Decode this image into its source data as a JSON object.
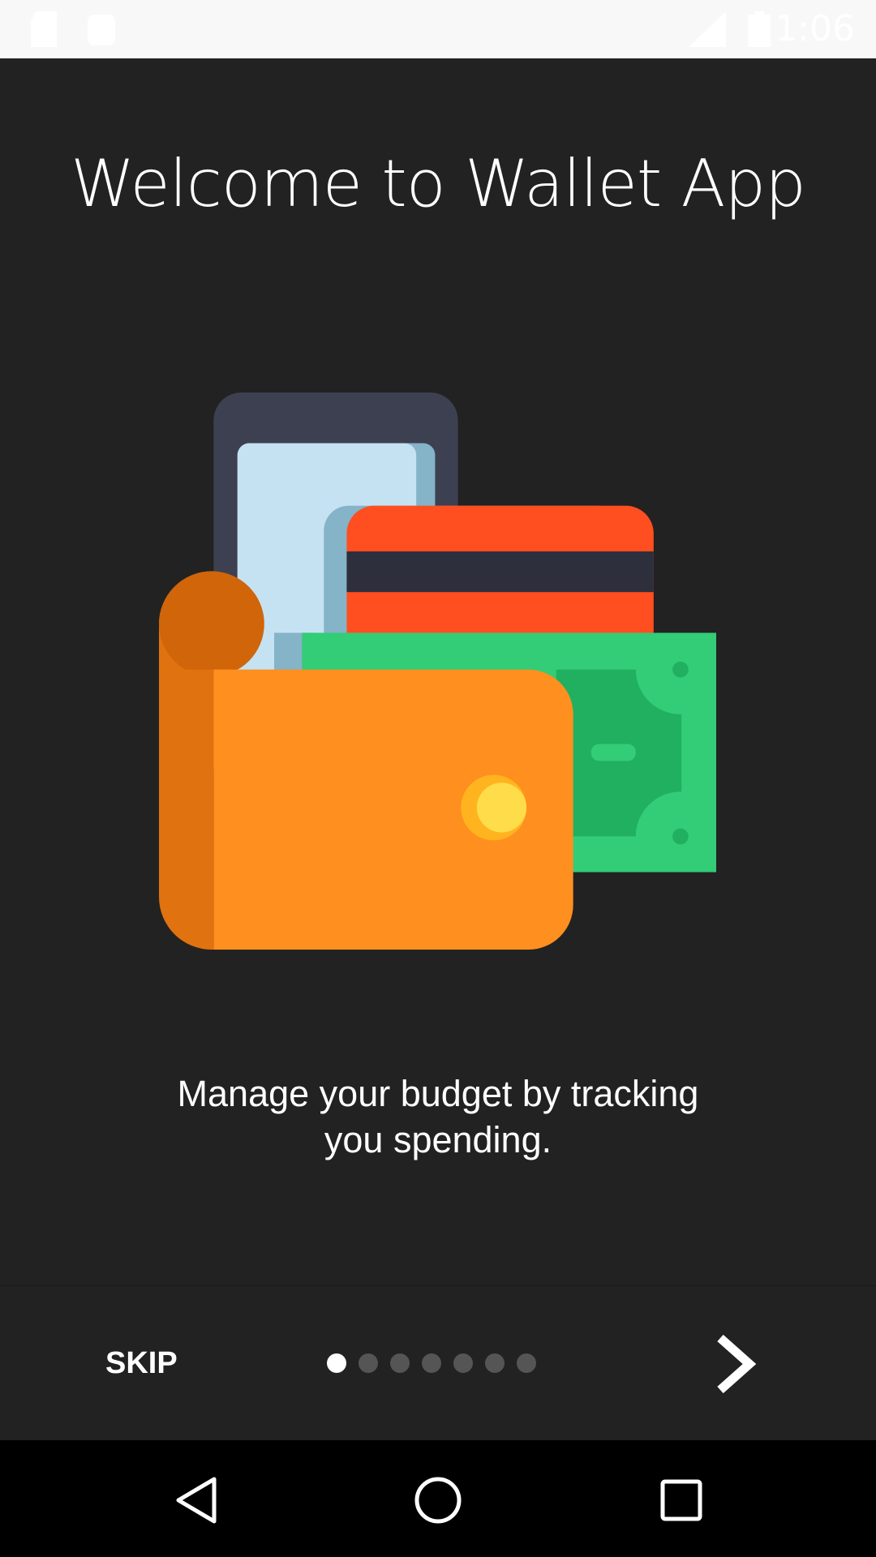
{
  "status_bar": {
    "time": "1:06",
    "icons": [
      "sd-card-icon",
      "android-icon",
      "lte-signal-icon",
      "battery-charging-icon"
    ]
  },
  "title": "Welcome to Wallet App",
  "illustration": {
    "icon": "wallet-with-cards-and-cash"
  },
  "description": {
    "line1": "Manage your budget by tracking",
    "line2": "you spending."
  },
  "bottom_bar": {
    "skip_label": "SKIP",
    "page_count": 7,
    "current_page": 1,
    "next_icon": "chevron-right-icon"
  },
  "nav_bar": {
    "icons": [
      "back-icon",
      "home-icon",
      "recents-icon"
    ]
  },
  "colors": {
    "background": "#222222",
    "wallet": "#ff8f1f",
    "card": "#ff4e1f",
    "cash": "#33cc77"
  }
}
